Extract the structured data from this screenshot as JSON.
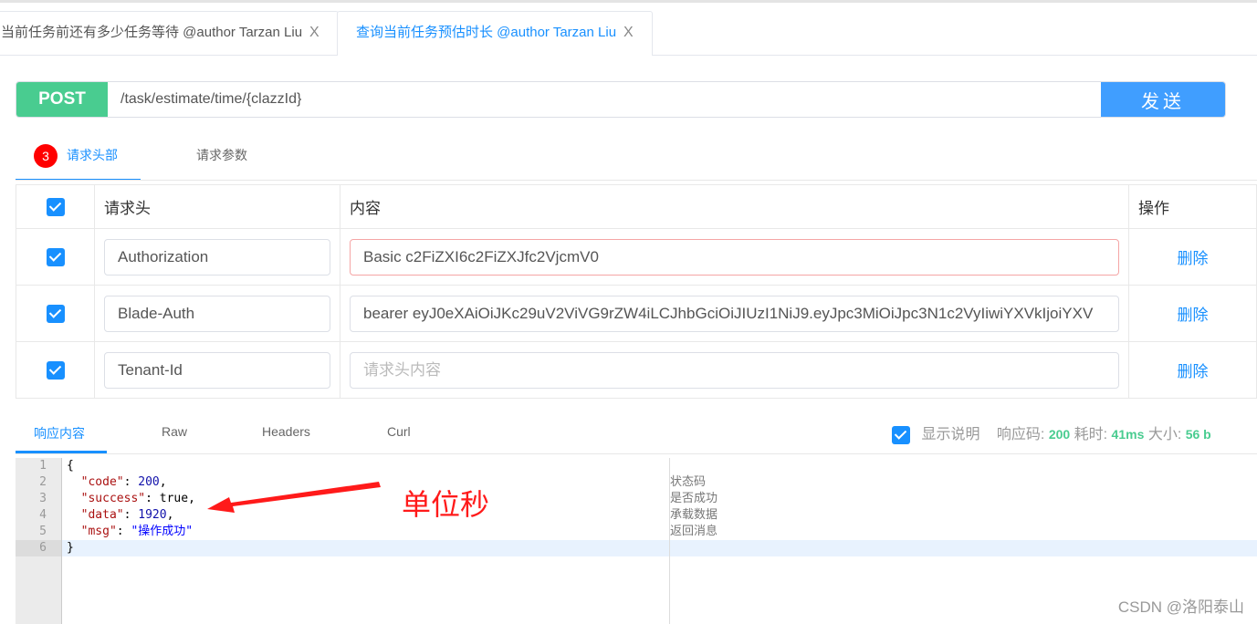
{
  "tabs": [
    {
      "label": "当前任务前还有多少任务等待 @author Tarzan Liu",
      "active": false
    },
    {
      "label": "查询当前任务预估时长 @author Tarzan Liu",
      "active": true
    }
  ],
  "close_glyph": "X",
  "request": {
    "method": "POST",
    "url": "/task/estimate/time/{clazzId}",
    "send_label": "发送"
  },
  "subtabs": {
    "headers_count": "3",
    "headers_label": "请求头部",
    "params_label": "请求参数"
  },
  "table": {
    "columns": [
      "请求头",
      "内容",
      "操作"
    ],
    "rows": [
      {
        "key": "Authorization",
        "value": "Basic c2FiZXI6c2FiZXJfc2VjcmV0",
        "action": "删除"
      },
      {
        "key": "Blade-Auth",
        "value": "bearer eyJ0eXAiOiJKc29uV2ViVG9rZW4iLCJhbGciOiJIUzI1NiJ9.eyJpc3MiOiJpc3N1c2VyIiwiYXVkIjoiYXV",
        "action": "删除"
      },
      {
        "key": "Tenant-Id",
        "value": "",
        "placeholder": "请求头内容",
        "action": "删除"
      }
    ]
  },
  "response": {
    "tabs": [
      "响应内容",
      "Raw",
      "Headers",
      "Curl"
    ],
    "show_desc": "显示说明",
    "code_label": "响应码:",
    "code": "200",
    "time_label": "耗时:",
    "time": "41ms",
    "size_label": "大小:",
    "size": "56 b",
    "lines": [
      "1",
      "2",
      "3",
      "4",
      "5",
      "6"
    ],
    "json": {
      "open": "{",
      "code_key": "\"code\"",
      "code_val": "200",
      "success_key": "\"success\"",
      "success_val": "true",
      "data_key": "\"data\"",
      "data_val": "1920",
      "msg_key": "\"msg\"",
      "msg_val": "\"操作成功\"",
      "close": "}"
    },
    "notes": [
      "状态码",
      "是否成功",
      "承载数据",
      "返回消息"
    ]
  },
  "annotation": "单位秒",
  "watermark": "CSDN @洛阳泰山",
  "colors": {
    "accent": "#1890ff",
    "post": "#49cc90",
    "send": "#409eff",
    "annotation": "#ff1a1a"
  }
}
